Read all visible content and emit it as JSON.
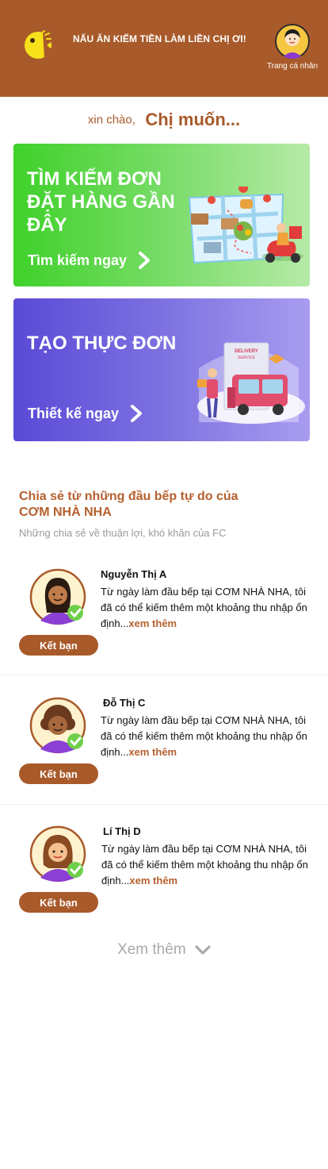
{
  "header": {
    "title": "NẤU ĂN KIẾM TIỀN LÀM LIỀN CHỊ ƠI!",
    "profile_label": "Trang cá nhân",
    "colors": {
      "background": "#a95a2a",
      "logo": "#f7e11b"
    }
  },
  "greeting": {
    "small": "xin chào,",
    "big": "Chị muốn..."
  },
  "cards": [
    {
      "title": "TÌM KIẾM ĐƠN ĐẶT HÀNG GẦN ĐÂY",
      "action": "Tìm kiếm ngay",
      "icon": "map-delivery-illustration"
    },
    {
      "title": "TẠO THỰC ĐƠN",
      "action": "Thiết kế ngay",
      "icon": "delivery-truck-illustration",
      "truck_sign": "DELIVERY SERVICE"
    }
  ],
  "section": {
    "title": "Chia sẻ từ những đầu bếp tự do của CƠM NHÀ NHA",
    "subtitle": "Những chia sẻ về thuận lợi, khó khăn của FC"
  },
  "chefs": [
    {
      "name": "Nguyễn Thị A",
      "text": "Từ ngày làm đầu bếp tại CƠM NHÀ NHA, tôi đã có thể kiếm thêm một khoảng thu nhập ổn định...",
      "more": "xem thêm",
      "button": "Kết bạn"
    },
    {
      "name": "Đỗ Thị C",
      "text": "Từ ngày làm đầu bếp tại CƠM NHÀ NHA, tôi đã có thể kiếm thêm một khoảng thu nhập ổn định...",
      "more": "xem thêm",
      "button": "Kết bạn"
    },
    {
      "name": "Lí Thị D",
      "text": "Từ ngày làm đầu bếp tại CƠM NHÀ NHA, tôi đã có thể kiếm thêm một khoảng thu nhập ổn định...",
      "more": "xem thêm",
      "button": "Kết bạn"
    }
  ],
  "see_more": "Xem thêm"
}
